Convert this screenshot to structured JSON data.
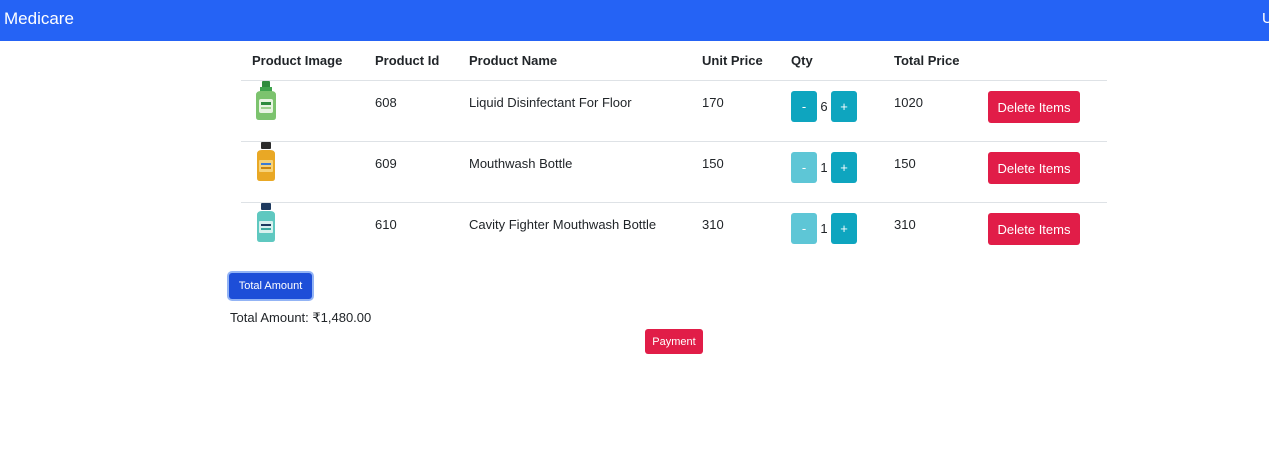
{
  "navbar": {
    "brand": "Medicare",
    "right_text": "U",
    "color": "#2563f5"
  },
  "table": {
    "headers": [
      "Product Image",
      "Product Id",
      "Product Name",
      "Unit Price",
      "Qty",
      "Total Price"
    ],
    "rows": [
      {
        "image": "green-disinfectant-bottle",
        "id": "608",
        "name": "Liquid Disinfectant For Floor",
        "unit_price": "170",
        "qty": "6",
        "total": "1020",
        "delete_label": "Delete Items"
      },
      {
        "image": "yellow-mouthwash-bottle",
        "id": "609",
        "name": "Mouthwash Bottle",
        "unit_price": "150",
        "qty": "1",
        "total": "150",
        "delete_label": "Delete Items"
      },
      {
        "image": "teal-mouthwash-bottle",
        "id": "610",
        "name": "Cavity Fighter Mouthwash Bottle",
        "unit_price": "310",
        "qty": "1",
        "total": "310",
        "delete_label": "Delete Items"
      }
    ],
    "minus_label": "-",
    "plus_label": "+"
  },
  "summary": {
    "total_button_label": "Total Amount",
    "total_text": "Total Amount: ₹1,480.00",
    "payment_label": "Payment"
  },
  "colors": {
    "primary": "#1d4ed8",
    "danger": "#e11d48",
    "info": "#0ea5bf"
  }
}
